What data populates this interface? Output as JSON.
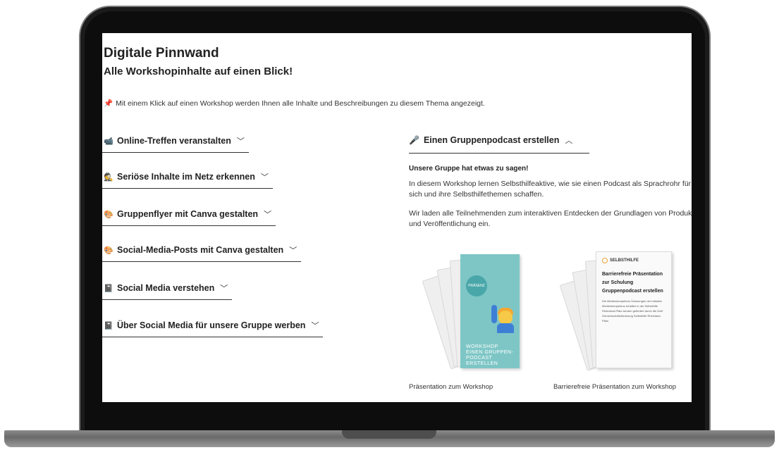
{
  "page": {
    "title": "Digitale Pinnwand",
    "subtitle": "Alle Workshopinhalte auf einen Blick!",
    "hint": "Mit einem Klick auf einen Workshop werden Ihnen alle Inhalte und Beschreibungen zu diesem Thema angezeigt."
  },
  "workshops": [
    {
      "label": "Online-Treffen veranstalten",
      "icon": "video-camera-icon"
    },
    {
      "label": "Seriöse Inhalte im Netz erkennen",
      "icon": "detective-icon"
    },
    {
      "label": "Gruppenflyer mit Canva gestalten",
      "icon": "palette-icon"
    },
    {
      "label": "Social-Media-Posts mit Canva gestalten",
      "icon": "palette-icon"
    },
    {
      "label": "Social Media verstehen",
      "icon": "notebook-icon"
    },
    {
      "label": "Über Social Media für unsere Gruppe werben",
      "icon": "notebook-icon"
    }
  ],
  "podcast": {
    "heading": "Einen Gruppenpodcast erstellen",
    "icon": "microphone-icon",
    "tagline": "Unsere Gruppe hat etwas zu sagen!",
    "text1": "In diesem Workshop lernen Selbsthilfeaktive, wie sie einen Podcast als Sprachrohr für sich und ihre Selbsthilfethemen schaffen.",
    "text2": "Wir laden alle Teilnehmenden zum interaktiven Entdecken der Grundlagen von Produktion und Veröffentlichung ein.",
    "book1": {
      "badge": "PRÄSENZ",
      "cover_text": "WORKSHOP EINEN GRUPPEN- PODCAST ERSTELLEN",
      "caption": "Präsentation zum Workshop"
    },
    "book2": {
      "logo": "SELBSTHILFE",
      "cover_title": "Barrierefreie Präsentation zur Schulung Gruppenpodcast erstellen",
      "cover_desc": "Die Medienkompetenz-Schulungen der Initiative Medienkompetenz erhalten in der Selbsthilfe Rheinland-Pfalz werden gefördert durch die DAK Gemeinschaftsförderung Selbsthilfe Rheinland-Pfalz.",
      "caption": "Barrierefreie Präsentation zum Workshop"
    }
  },
  "colors": {
    "pin": "#e0245e",
    "cover_teal": "#7ec6c6"
  }
}
